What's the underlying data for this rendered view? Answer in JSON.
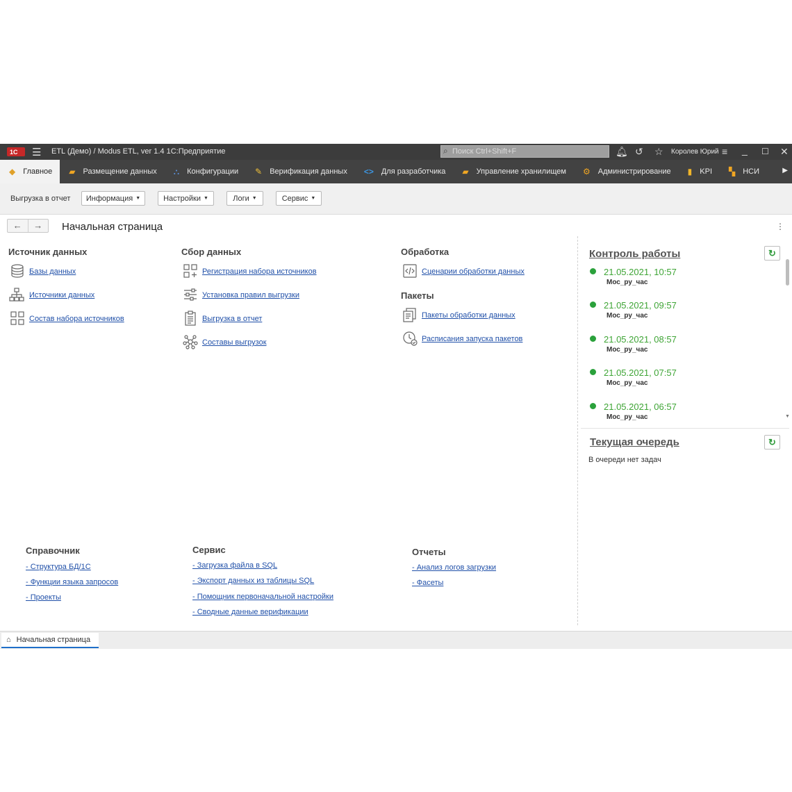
{
  "window": {
    "title": "ETL (Демо) / Modus ETL, ver 1.4 1С:Предприятие",
    "search_placeholder": "Поиск Ctrl+Shift+F",
    "user": "Королев Юрий"
  },
  "tabs": [
    {
      "label": "Главное",
      "icon": "cube-icon",
      "color": "#e0a12a"
    },
    {
      "label": "Размещение данных",
      "icon": "database-icon",
      "color": "#f0a623"
    },
    {
      "label": "Конфигурации",
      "icon": "hierarchy-icon",
      "color": "#5b8ed6"
    },
    {
      "label": "Верификация данных",
      "icon": "magic-wand-icon",
      "color": "#f0c03a"
    },
    {
      "label": "Для разработчика",
      "icon": "code-icon",
      "color": "#3d95e0"
    },
    {
      "label": "Управление хранилищем",
      "icon": "storage-icon",
      "color": "#f0a623"
    },
    {
      "label": "Администрирование",
      "icon": "gear-icon",
      "color": "#f0a623"
    },
    {
      "label": "KPI",
      "icon": "bar-chart-icon",
      "color": "#f0b52a"
    },
    {
      "label": "НСИ",
      "icon": "book-icon",
      "color": "#f0a623"
    }
  ],
  "toolbar": {
    "export": "Выгрузка в отчет",
    "info": "Информация",
    "settings": "Настройки",
    "logs": "Логи",
    "service": "Сервис"
  },
  "page": {
    "title": "Начальная страница"
  },
  "sources": {
    "heading": "Источник данных",
    "links": [
      "Базы данных",
      "Источники данных",
      "Состав набора источников"
    ]
  },
  "collect": {
    "heading": "Сбор данных",
    "links": [
      "Регистрация набора источников",
      "Установка правил выгрузки",
      "Выгрузка в отчет",
      "Составы выгрузок"
    ]
  },
  "processing": {
    "heading": "Обработка",
    "links": [
      "Сценарии обработки данных"
    ]
  },
  "packages": {
    "heading": "Пакеты",
    "links": [
      "Пакеты обработки данных",
      "Расписания запуска пакетов"
    ]
  },
  "reference": {
    "heading": "Справочник",
    "links": [
      "- Структура БД/1С",
      "- Функции языка запросов",
      "- Проекты"
    ]
  },
  "service": {
    "heading": "Сервис",
    "links": [
      "- Загрузка файла в SQL",
      "- Экспорт данных из таблицы SQL",
      "- Помощник первоначальной настройки",
      "- Сводные данные верификации"
    ]
  },
  "reports": {
    "heading": "Отчеты",
    "links": [
      "- Анализ логов загрузки",
      "- Фасеты"
    ]
  },
  "control": {
    "heading": "Контроль работы",
    "entries": [
      {
        "date": "21.05.2021, 10:57",
        "name": "Мос_ру_час"
      },
      {
        "date": "21.05.2021, 09:57",
        "name": "Мос_ру_час"
      },
      {
        "date": "21.05.2021, 08:57",
        "name": "Мос_ру_час"
      },
      {
        "date": "21.05.2021, 07:57",
        "name": "Мос_ру_час"
      },
      {
        "date": "21.05.2021, 06:57",
        "name": "Мос_ру_час"
      }
    ],
    "status_color": "#2aa13b"
  },
  "queue": {
    "heading": "Текущая очередь",
    "empty_text": "В очереди нет задач"
  },
  "bottom": {
    "open_tab": "Начальная страница"
  }
}
